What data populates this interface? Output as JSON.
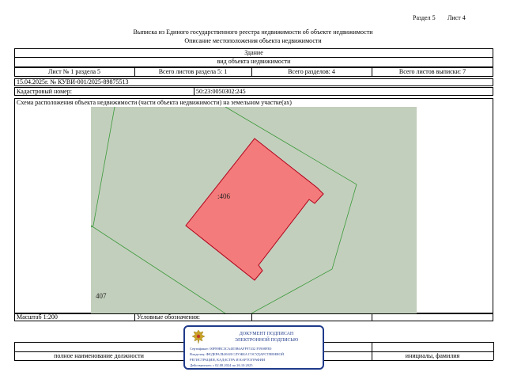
{
  "header": {
    "section": "Раздел 5",
    "sheet": "Лист 4",
    "title": "Выписка из Единого государственного реестра недвижимости об объекте недвижимости",
    "subtitle": "Описание местоположения объекта недвижимости"
  },
  "object": {
    "type_value": "Здание",
    "type_label": "вид объекта недвижимости"
  },
  "sheets": {
    "sheet_no": "Лист № 1 раздела 5",
    "total_section": "Всего листов раздела 5: 1",
    "total_sections": "Всего разделов: 4",
    "total_extract": "Всего листов выписки: 7"
  },
  "doc": {
    "date_number": "15.04.2025г. № КУВИ-001/2025-89875513",
    "cadastral_label": "Кадастровый номер:",
    "cadastral_value": "50:23:0050302:245"
  },
  "scheme": {
    "title": "Схема расположения объекта недвижимости (части объекта недвижимости) на земельном участке(ах)",
    "label_406": ":406",
    "label_407": "407",
    "colors": {
      "background": "#c3cfbd",
      "building_fill": "#f47b7b",
      "building_stroke": "#b0001a",
      "boundary": "#3a9a3a"
    }
  },
  "footer": {
    "scale": "Масштаб 1:200",
    "legend": "Условные обозначения:",
    "position_label": "полное наименование должности",
    "name_label": "инициалы, фамилия"
  },
  "stamp": {
    "line1": "ДОКУМЕНТ ПОДПИСАН",
    "line2": "ЭЛЕКТРОННОЙ ПОДПИСЬЮ",
    "cert": "Сертификат: 00F89BC3CA4E5B6AFF97432 F5908FE0",
    "owner1": "Владелец: ФЕДЕРАЛЬНАЯ СЛУЖБА ГОСУДАРСТВЕННОЙ",
    "owner2": "РЕГИСТРАЦИИ, КАДАСТРА И КАРТОГРАФИИ",
    "valid": "Действителен: с 02.08.2024 по 26.10.2025"
  }
}
